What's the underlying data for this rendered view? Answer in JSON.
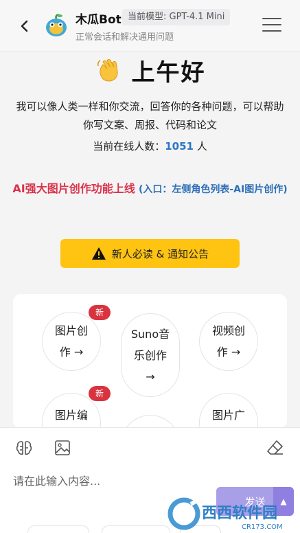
{
  "header": {
    "title": "木瓜Bot",
    "model_badge": "当前模型: GPT-4.1 Mini",
    "subtitle": "正常会话和解决通用问题"
  },
  "greeting": {
    "text": "上午好",
    "intro": "我可以像人类一样和你交流，回答你的各种问题，可以帮助你写文案、周报、代码和论文",
    "online_label": "当前在线人数：",
    "online_count": "1051",
    "online_unit": " 人"
  },
  "promo": {
    "headline": "AI强大图片创作功能上线",
    "entry": "(入口：左侧角色列表-AI图片创作)"
  },
  "notice_button": {
    "label": "新人必读 & 通知公告"
  },
  "features": [
    {
      "label": "图片创作 →",
      "badge": "新"
    },
    {
      "label": "Suno音乐创作 →"
    },
    {
      "label": "视频创作 →"
    },
    {
      "label": "图片编",
      "badge": "新"
    },
    {
      "label": "图片广"
    }
  ],
  "composer": {
    "placeholder": "请在此输入内容...",
    "send_label": "发送"
  },
  "watermark": {
    "text": "西西软件园",
    "sub": "CR173.COM"
  },
  "colors": {
    "accent_blue": "#2a76c6",
    "promo_red": "#d9334a",
    "notice_yellow": "#ffc312",
    "send_purple": "#a99ee8",
    "badge_red": "#d9333f"
  }
}
